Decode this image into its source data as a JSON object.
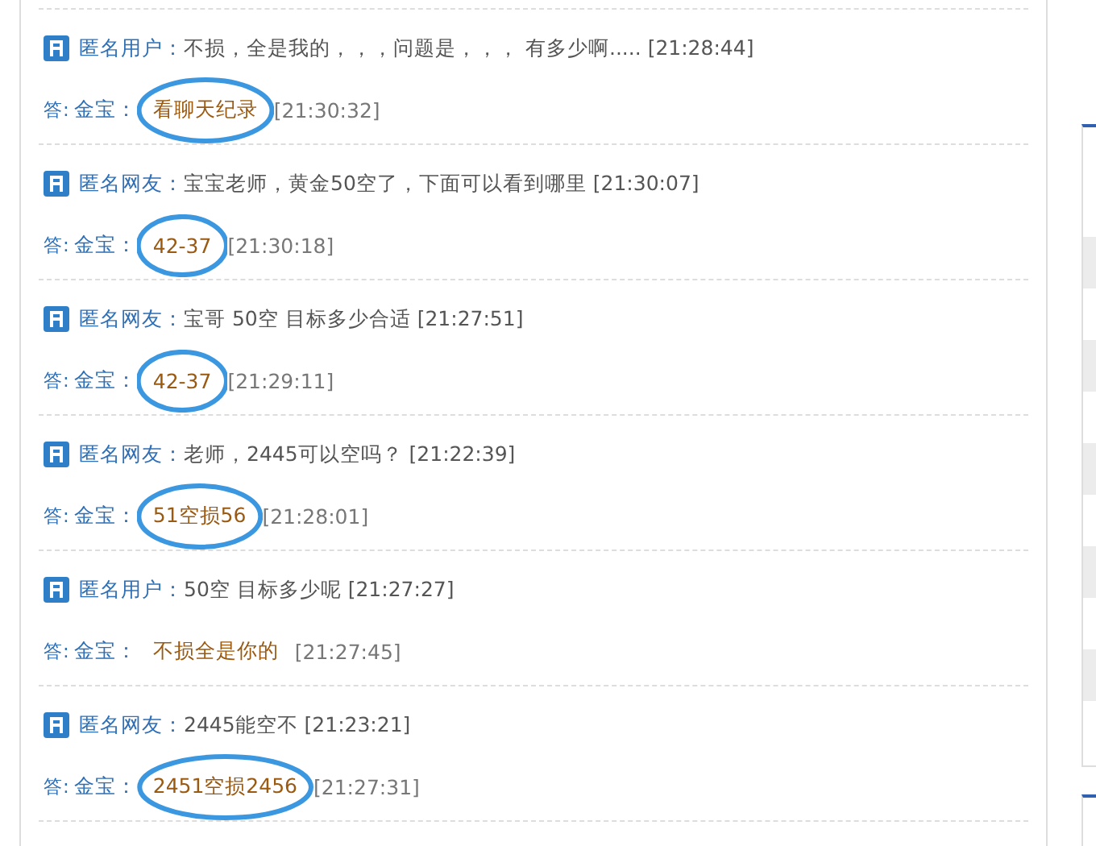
{
  "messages": [
    {
      "asker": "匿名用户：",
      "question": "不损，全是我的，，，问题是，，，  有多少啊.....",
      "q_time": "[21:28:44]",
      "answer_label": "答:",
      "answerer": "金宝",
      "colon": "：",
      "answer": "看聊天纪录",
      "a_time": "[21:30:32]",
      "circled": true
    },
    {
      "asker": "匿名网友：",
      "question": "宝宝老师，黄金50空了，下面可以看到哪里",
      "q_time": "[21:30:07]",
      "answer_label": "答:",
      "answerer": "金宝",
      "colon": "：",
      "answer": "42-37",
      "a_time": "[21:30:18]",
      "circled": true
    },
    {
      "asker": "匿名网友：",
      "question": "宝哥 50空 目标多少合适",
      "q_time": "[21:27:51]",
      "answer_label": "答:",
      "answerer": "金宝",
      "colon": "：",
      "answer": "42-37",
      "a_time": "[21:29:11]",
      "circled": true
    },
    {
      "asker": "匿名网友：",
      "question": "老师，2445可以空吗？",
      "q_time": "[21:22:39]",
      "answer_label": "答:",
      "answerer": "金宝",
      "colon": "：",
      "answer": "51空损56",
      "a_time": "[21:28:01]",
      "circled": true
    },
    {
      "asker": "匿名用户：",
      "question": "50空 目标多少呢",
      "q_time": "[21:27:27]",
      "answer_label": "答:",
      "answerer": "金宝",
      "colon": "：",
      "answer": "不损全是你的",
      "a_time": "[21:27:45]",
      "circled": false
    },
    {
      "asker": "匿名网友：",
      "question": "2445能空不",
      "q_time": "[21:23:21]",
      "answer_label": "答:",
      "answerer": "金宝",
      "colon": "：",
      "answer": "2451空损2456",
      "a_time": "[21:27:31]",
      "circled": true
    }
  ]
}
